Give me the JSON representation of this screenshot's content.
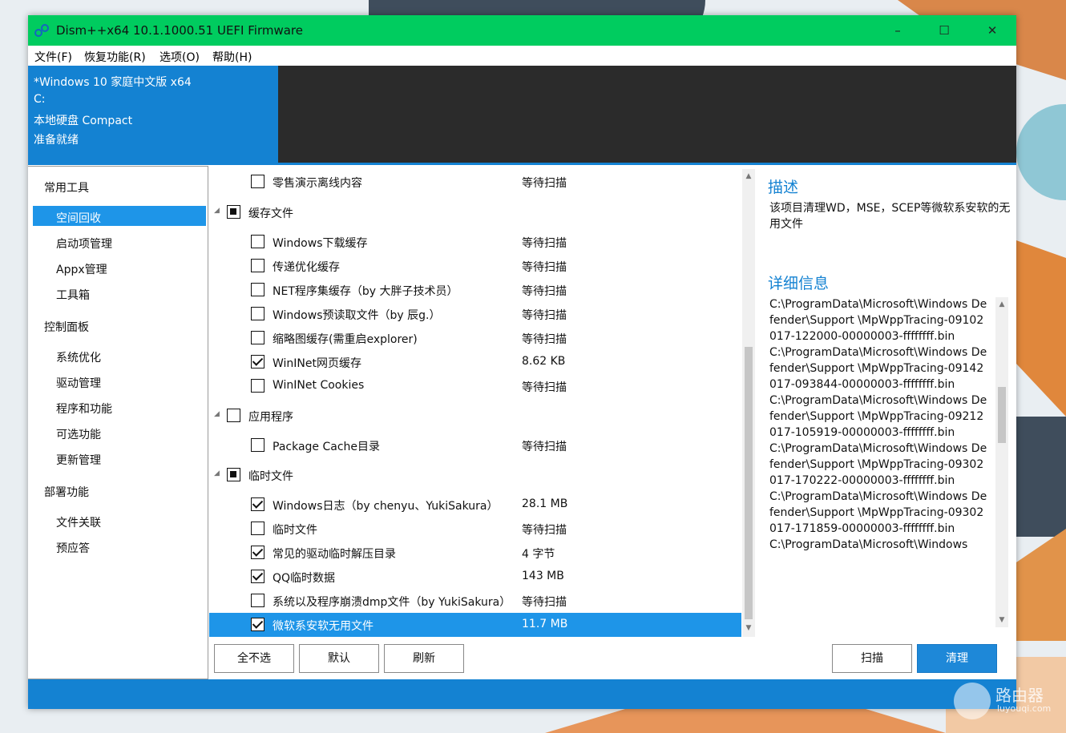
{
  "window": {
    "title": "Dism++x64 10.1.1000.51 UEFI Firmware",
    "controls": {
      "minimize": "–",
      "maximize": "☐",
      "close": "✕"
    }
  },
  "menu": [
    "文件(F)",
    "恢复功能(R)",
    "选项(O)",
    "帮助(H)"
  ],
  "system_info": [
    "*Windows 10 家庭中文版 x64",
    "C:",
    "本地硬盘 Compact",
    "准备就绪"
  ],
  "sidebar": {
    "groups": [
      {
        "label": "常用工具",
        "items": [
          "空间回收",
          "启动项管理",
          "Appx管理",
          "工具箱"
        ]
      },
      {
        "label": "控制面板",
        "items": [
          "系统优化",
          "驱动管理",
          "程序和功能",
          "可选功能",
          "更新管理"
        ]
      },
      {
        "label": "部署功能",
        "items": [
          "文件关联",
          "预应答"
        ]
      }
    ],
    "selected": "空间回收"
  },
  "cleanup_list": [
    {
      "type": "item",
      "label": "零售演示离线内容",
      "status": "等待扫描",
      "checked": false
    },
    {
      "type": "group",
      "label": "缓存文件",
      "state": "partial"
    },
    {
      "type": "item",
      "label": "Windows下载缓存",
      "status": "等待扫描",
      "checked": false
    },
    {
      "type": "item",
      "label": "传递优化缓存",
      "status": "等待扫描",
      "checked": false
    },
    {
      "type": "item",
      "label": "NET程序集缓存（by 大胖子技术员）",
      "status": "等待扫描",
      "checked": false
    },
    {
      "type": "item",
      "label": "Windows预读取文件（by 辰g.）",
      "status": "等待扫描",
      "checked": false
    },
    {
      "type": "item",
      "label": "缩略图缓存(需重启explorer)",
      "status": "等待扫描",
      "checked": false
    },
    {
      "type": "item",
      "label": "WinINet网页缓存",
      "status": "8.62 KB",
      "checked": true
    },
    {
      "type": "item",
      "label": "WinINet Cookies",
      "status": "等待扫描",
      "checked": false
    },
    {
      "type": "group",
      "label": "应用程序",
      "state": "unchecked"
    },
    {
      "type": "item",
      "label": "Package Cache目录",
      "status": "等待扫描",
      "checked": false
    },
    {
      "type": "group",
      "label": "临时文件",
      "state": "partial"
    },
    {
      "type": "item",
      "label": "Windows日志（by chenyu、YukiSakura）",
      "status": "28.1 MB",
      "checked": true
    },
    {
      "type": "item",
      "label": "临时文件",
      "status": "等待扫描",
      "checked": false
    },
    {
      "type": "item",
      "label": "常见的驱动临时解压目录",
      "status": "4 字节",
      "checked": true
    },
    {
      "type": "item",
      "label": "QQ临时数据",
      "status": "143 MB",
      "checked": true
    },
    {
      "type": "item",
      "label": "系统以及程序崩溃dmp文件（by YukiSakura）",
      "status": "等待扫描",
      "checked": false
    },
    {
      "type": "item",
      "label": "微软系安软无用文件",
      "status": "11.7 MB",
      "checked": true,
      "selected": true
    }
  ],
  "description": {
    "title": "描述",
    "text": "该项目清理WD，MSE，SCEP等微软系安软的无用文件",
    "details_title": "详细信息",
    "details_lines": [
      "C:\\ProgramData\\Microsoft\\Windows Defender\\Support \\MpWppTracing-09102017-122000-00000003-ffffffff.bin",
      "C:\\ProgramData\\Microsoft\\Windows Defender\\Support \\MpWppTracing-09142017-093844-00000003-ffffffff.bin",
      "C:\\ProgramData\\Microsoft\\Windows Defender\\Support \\MpWppTracing-09212017-105919-00000003-ffffffff.bin",
      "C:\\ProgramData\\Microsoft\\Windows Defender\\Support \\MpWppTracing-09302017-170222-00000003-ffffffff.bin",
      "C:\\ProgramData\\Microsoft\\Windows Defender\\Support \\MpWppTracing-09302017-171859-00000003-ffffffff.bin",
      "C:\\ProgramData\\Microsoft\\Windows"
    ]
  },
  "buttons": {
    "deselect_all": "全不选",
    "default": "默认",
    "refresh": "刷新",
    "scan": "扫描",
    "clean": "清理"
  },
  "watermark": {
    "brand": "路由器",
    "site": "luyouqi.com"
  },
  "colors": {
    "titlebar": "#00cc5f",
    "accent": "#1482d2",
    "selection": "#1e95e8"
  }
}
